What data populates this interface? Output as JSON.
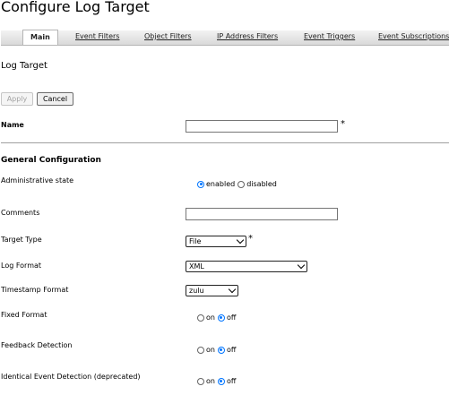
{
  "page": {
    "title": "Configure Log Target"
  },
  "tabs": [
    {
      "label": "Main",
      "active": true
    },
    {
      "label": "Event Filters"
    },
    {
      "label": "Object Filters"
    },
    {
      "label": "IP Address Filters"
    },
    {
      "label": "Event Triggers"
    },
    {
      "label": "Event Subscriptions"
    }
  ],
  "section": {
    "title": "Log Target"
  },
  "buttons": {
    "apply": "Apply",
    "cancel": "Cancel"
  },
  "form": {
    "name": {
      "label": "Name",
      "value": "",
      "required_mark": "*"
    },
    "general_heading": "General Configuration",
    "admin_state": {
      "label": "Administrative state",
      "options": [
        "enabled",
        "disabled"
      ],
      "selected": "enabled"
    },
    "comments": {
      "label": "Comments",
      "value": ""
    },
    "target_type": {
      "label": "Target Type",
      "value": "File",
      "required_mark": "*"
    },
    "log_format": {
      "label": "Log Format",
      "value": "XML"
    },
    "timestamp_format": {
      "label": "Timestamp Format",
      "value": "zulu"
    },
    "fixed_format": {
      "label": "Fixed Format",
      "options": [
        "on",
        "off"
      ],
      "selected": "off"
    },
    "feedback_detection": {
      "label": "Feedback Detection",
      "options": [
        "on",
        "off"
      ],
      "selected": "off"
    },
    "identical_event_detection": {
      "label": "Identical Event Detection (deprecated)",
      "options": [
        "on",
        "off"
      ],
      "selected": "off"
    }
  },
  "colors": {
    "radio_checked": "#0075ff",
    "tabbar": "#d9d9d9"
  }
}
